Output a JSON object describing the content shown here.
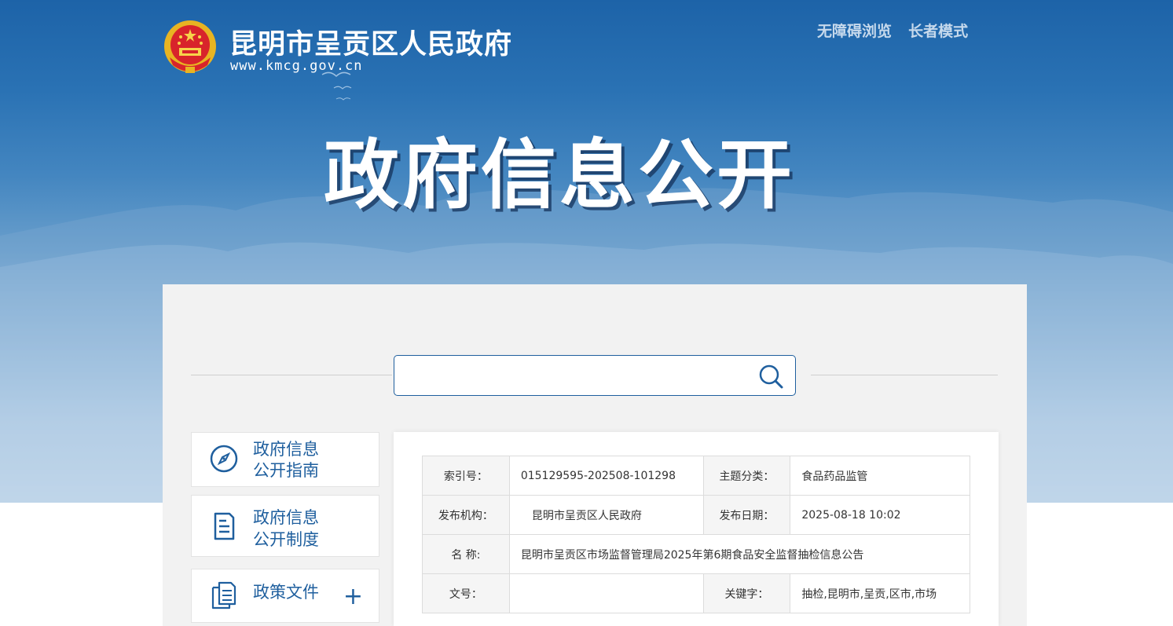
{
  "header": {
    "site_name": "昆明市呈贡区人民政府",
    "site_url": "www.kmcg.gov.cn",
    "links": [
      "无障碍浏览",
      "长者模式"
    ],
    "banner_title": "政府信息公开"
  },
  "search": {
    "value": "",
    "placeholder": ""
  },
  "sidebar": {
    "items": [
      {
        "line1": "政府信息",
        "line2": "公开指南",
        "icon": "compass-icon"
      },
      {
        "line1": "政府信息",
        "line2": "公开制度",
        "icon": "document-icon"
      },
      {
        "line1": "政策文件",
        "line2": "",
        "icon": "documents-icon",
        "expand": "+"
      }
    ]
  },
  "meta_table": {
    "rows": [
      {
        "k1": "索引号：",
        "v1": "015129595-202508-101298",
        "k2": "主题分类：",
        "v2": "食品药品监管"
      },
      {
        "k1": "发布机构：",
        "v1": "昆明市呈贡区人民政府",
        "k2": "发布日期：",
        "v2": "2025-08-18 10:02"
      },
      {
        "k1": "名 称:",
        "name": "昆明市呈贡区市场监督管理局2025年第6期食品安全监督抽检信息公告"
      },
      {
        "k1": "文号：",
        "v1": "",
        "k2": "关键字：",
        "v2": "抽检,昆明市,呈贡,区市,市场"
      }
    ]
  },
  "colors": {
    "accent": "#1f5f9e",
    "banner_top": "#1d63a8",
    "panel_bg": "#f2f2f2"
  }
}
